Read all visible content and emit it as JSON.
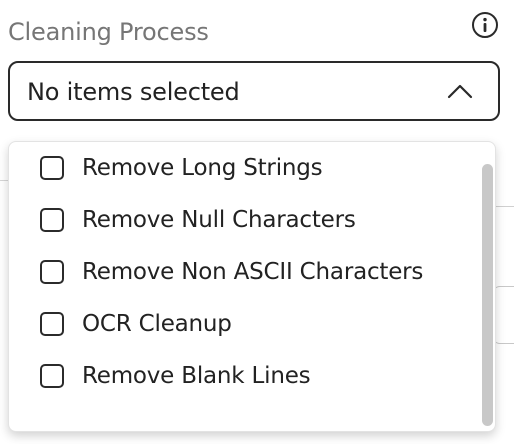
{
  "field": {
    "label": "Cleaning Process",
    "info_icon": "info-icon",
    "select": {
      "value": "No items selected",
      "state": "expanded",
      "chevron_icon": "chevron-up-icon"
    }
  },
  "dropdown": {
    "options": [
      {
        "label": "Remove Long Strings",
        "checked": false
      },
      {
        "label": "Remove Null Characters",
        "checked": false
      },
      {
        "label": "Remove Non ASCII Characters",
        "checked": false
      },
      {
        "label": "OCR Cleanup",
        "checked": false
      },
      {
        "label": "Remove Blank Lines",
        "checked": false
      }
    ]
  },
  "colors": {
    "label_text": "#767676",
    "border": "#2a2a2a",
    "text": "#222222",
    "scrollbar_thumb": "#c8c8c8"
  }
}
